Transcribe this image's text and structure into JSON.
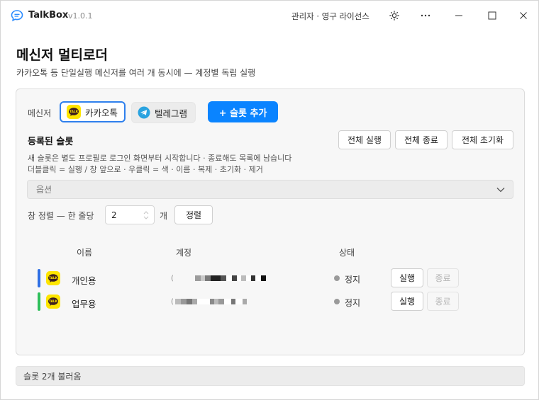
{
  "window": {
    "app_name": "TalkBox",
    "version": "v1.0.1",
    "license": "관리자 · 영구 라이선스"
  },
  "page": {
    "title": "메신저 멀티로더",
    "subtitle": "카카오톡 등 단일실행 메신저를 여러 개 동시에 — 계정별 독립 실행"
  },
  "panel": {
    "messenger_label": "메신저",
    "messengers": [
      {
        "label": "카카오톡",
        "selected": true
      },
      {
        "label": "텔레그램",
        "selected": false
      }
    ],
    "add_slot_label": "+ 슬롯 추가",
    "slots_heading": "등록된 슬롯",
    "bulk_buttons": {
      "run_all": "전체 실행",
      "stop_all": "전체 종료",
      "reset_all": "전체 초기화"
    },
    "hint_line1": "새 슬롯은 별도 프로필로 로그인 화면부터 시작합니다 · 종료해도 목록에 남습니다",
    "hint_line2": "더블클릭 = 실행 / 창 앞으로  ·  우클릭 = 색 · 이름 · 복제 · 초기화 · 제거",
    "options_label": "옵션",
    "arrange_label": "창 정렬 — 한 줄당",
    "arrange_count": "2",
    "arrange_unit": "개",
    "sort_label": "정렬",
    "table": {
      "headers": {
        "name": "이름",
        "account": "계정",
        "status": "상태"
      },
      "rows": [
        {
          "color": "#2f6fe4",
          "name": "개인용",
          "account_prefix": "(",
          "status": "정지",
          "run": "실행",
          "stop": "종료"
        },
        {
          "color": "#2fbf5b",
          "name": "업무용",
          "account_prefix": "(",
          "status": "정지",
          "run": "실행",
          "stop": "종료"
        }
      ]
    }
  },
  "statusbar": {
    "text": "슬롯 2개 불러옴"
  },
  "colors": {
    "accent": "#0a84ff",
    "kakao_yellow": "#fee500",
    "telegram_blue": "#2aa3e0"
  }
}
